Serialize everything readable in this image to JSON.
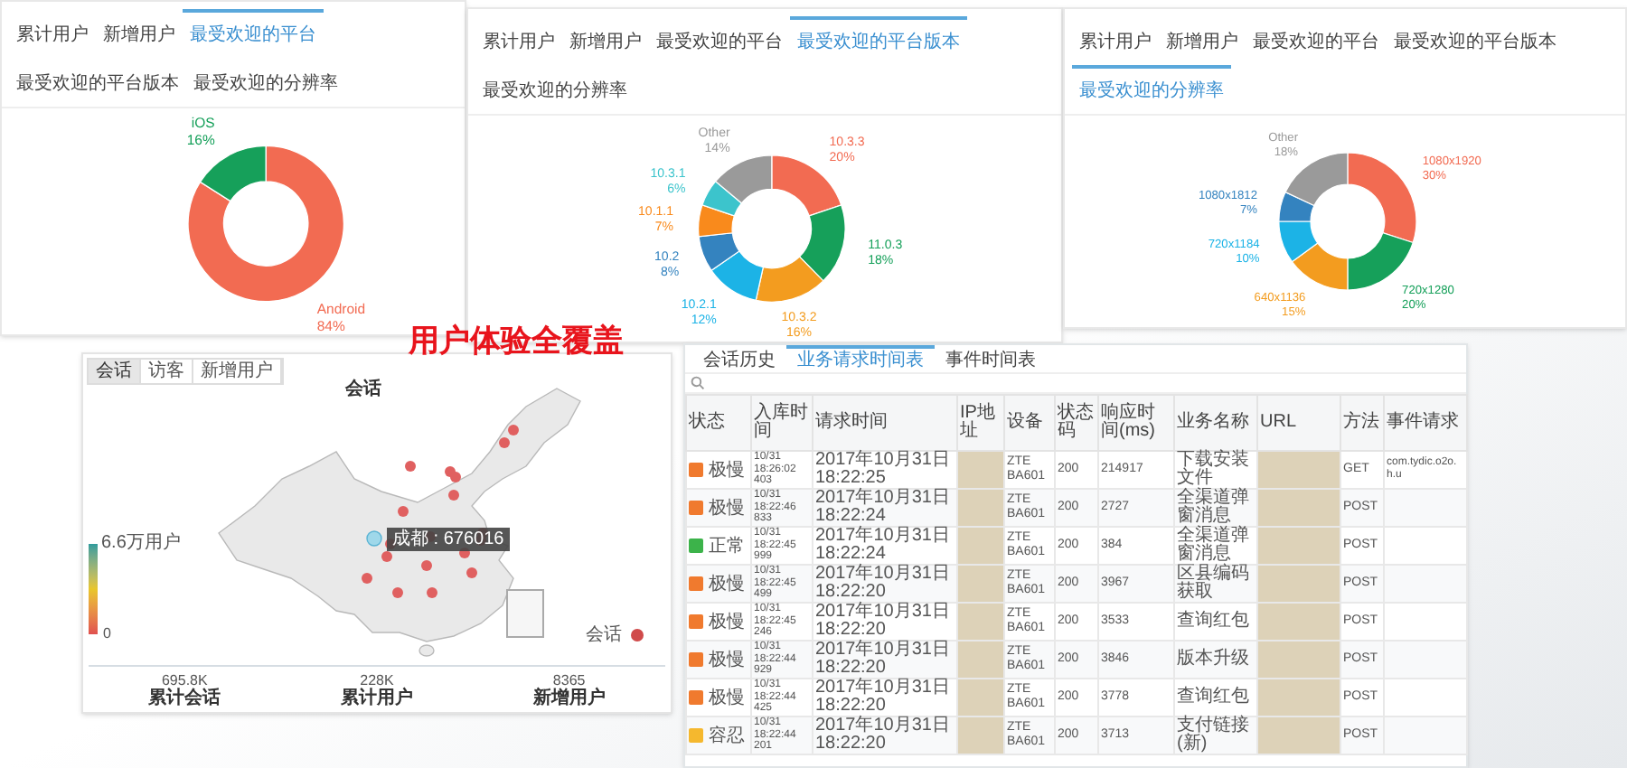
{
  "chart_panels": [
    {
      "tabs": [
        {
          "label": "累计用户",
          "selected": false
        },
        {
          "label": "新增用户",
          "selected": false
        },
        {
          "label": "最受欢迎的平台",
          "selected": true
        },
        {
          "label": "最受欢迎的平台版本",
          "selected": false
        },
        {
          "label": "最受欢迎的分辨率",
          "selected": false
        }
      ],
      "chart_data": {
        "type": "donut",
        "categories": [
          "Android",
          "iOS"
        ],
        "values": [
          84,
          16
        ],
        "value_labels": [
          "84%",
          "16%"
        ]
      }
    },
    {
      "tabs": [
        {
          "label": "累计用户",
          "selected": false
        },
        {
          "label": "新增用户",
          "selected": false
        },
        {
          "label": "最受欢迎的平台",
          "selected": false
        },
        {
          "label": "最受欢迎的平台版本",
          "selected": true
        },
        {
          "label": "最受欢迎的分辨率",
          "selected": false
        }
      ],
      "chart_data": {
        "type": "donut",
        "categories": [
          "10.3.3",
          "11.0.3",
          "10.3.2",
          "10.2.1",
          "10.2",
          "10.1.1",
          "10.3.1",
          "Other"
        ],
        "values": [
          20,
          18,
          16,
          12,
          8,
          7,
          6,
          14
        ],
        "value_labels": [
          "20%",
          "18%",
          "16%",
          "12%",
          "8%",
          "7%",
          "6%",
          "14%"
        ]
      }
    },
    {
      "tabs": [
        {
          "label": "累计用户",
          "selected": false
        },
        {
          "label": "新增用户",
          "selected": false
        },
        {
          "label": "最受欢迎的平台",
          "selected": false
        },
        {
          "label": "最受欢迎的平台版本",
          "selected": false
        },
        {
          "label": "最受欢迎的分辨率",
          "selected": true
        }
      ],
      "chart_data": {
        "type": "donut",
        "categories": [
          "1080x1920",
          "720x1280",
          "640x1136",
          "720x1184",
          "1080x1812",
          "Other"
        ],
        "values": [
          30,
          20,
          15,
          10,
          7,
          18
        ],
        "value_labels": [
          "30%",
          "20%",
          "15%",
          "10%",
          "7%",
          "18%"
        ]
      }
    }
  ],
  "headline": "用户体验全覆盖",
  "map_panel": {
    "tabs": [
      {
        "label": "会话",
        "selected": true
      },
      {
        "label": "访客",
        "selected": false
      },
      {
        "label": "新增用户",
        "selected": false
      }
    ],
    "title": "会话",
    "scale_max": "6.6万用户",
    "scale_min": "0",
    "tooltip": "成都 : 676016",
    "legend": "会话",
    "stats": [
      {
        "value": "695.8K",
        "label": "累计会话"
      },
      {
        "value": "228K",
        "label": "累计用户"
      },
      {
        "value": "8365",
        "label": "新增用户"
      }
    ]
  },
  "table_panel": {
    "tabs": [
      {
        "label": "会话历史",
        "selected": false
      },
      {
        "label": "业务请求时间表",
        "selected": true
      },
      {
        "label": "事件时间表",
        "selected": false
      }
    ],
    "columns": [
      "状态",
      "入库时间",
      "请求时间",
      "IP地址",
      "设备",
      "状态码",
      "响应时间(ms)",
      "业务名称",
      "URL",
      "方法",
      "事件请求"
    ],
    "rows": [
      {
        "status": "极慢",
        "color": "#f07a2e",
        "received": "10/31 18:26:02 403",
        "requested": "2017年10月31日 18:22:25",
        "device": "ZTE BA601",
        "code": "200",
        "response_ms": "214917",
        "business": "下载安装文件",
        "method": "GET",
        "event": "com.tydic.o2o.h.u"
      },
      {
        "status": "极慢",
        "color": "#f07a2e",
        "received": "10/31 18:22:46 833",
        "requested": "2017年10月31日 18:22:24",
        "device": "ZTE BA601",
        "code": "200",
        "response_ms": "2727",
        "business": "全渠道弹窗消息",
        "method": "POST"
      },
      {
        "status": "正常",
        "color": "#3cb34a",
        "received": "10/31 18:22:45 999",
        "requested": "2017年10月31日 18:22:24",
        "device": "ZTE BA601",
        "code": "200",
        "response_ms": "384",
        "business": "全渠道弹窗消息",
        "method": "POST"
      },
      {
        "status": "极慢",
        "color": "#f07a2e",
        "received": "10/31 18:22:45 499",
        "requested": "2017年10月31日 18:22:20",
        "device": "ZTE BA601",
        "code": "200",
        "response_ms": "3967",
        "business": "区县编码获取",
        "method": "POST"
      },
      {
        "status": "极慢",
        "color": "#f07a2e",
        "received": "10/31 18:22:45 246",
        "requested": "2017年10月31日 18:22:20",
        "device": "ZTE BA601",
        "code": "200",
        "response_ms": "3533",
        "business": "查询红包",
        "method": "POST"
      },
      {
        "status": "极慢",
        "color": "#f07a2e",
        "received": "10/31 18:22:44 929",
        "requested": "2017年10月31日 18:22:20",
        "device": "ZTE BA601",
        "code": "200",
        "response_ms": "3846",
        "business": "版本升级",
        "method": "POST"
      },
      {
        "status": "极慢",
        "color": "#f07a2e",
        "received": "10/31 18:22:44 425",
        "requested": "2017年10月31日 18:22:20",
        "device": "ZTE BA601",
        "code": "200",
        "response_ms": "3778",
        "business": "查询红包",
        "method": "POST"
      },
      {
        "status": "容忍",
        "color": "#f5b82e",
        "received": "10/31 18:22:44 201",
        "requested": "2017年10月31日 18:22:20",
        "device": "ZTE BA601",
        "code": "200",
        "response_ms": "3713",
        "business": "支付链接(新)",
        "method": "POST"
      }
    ]
  }
}
